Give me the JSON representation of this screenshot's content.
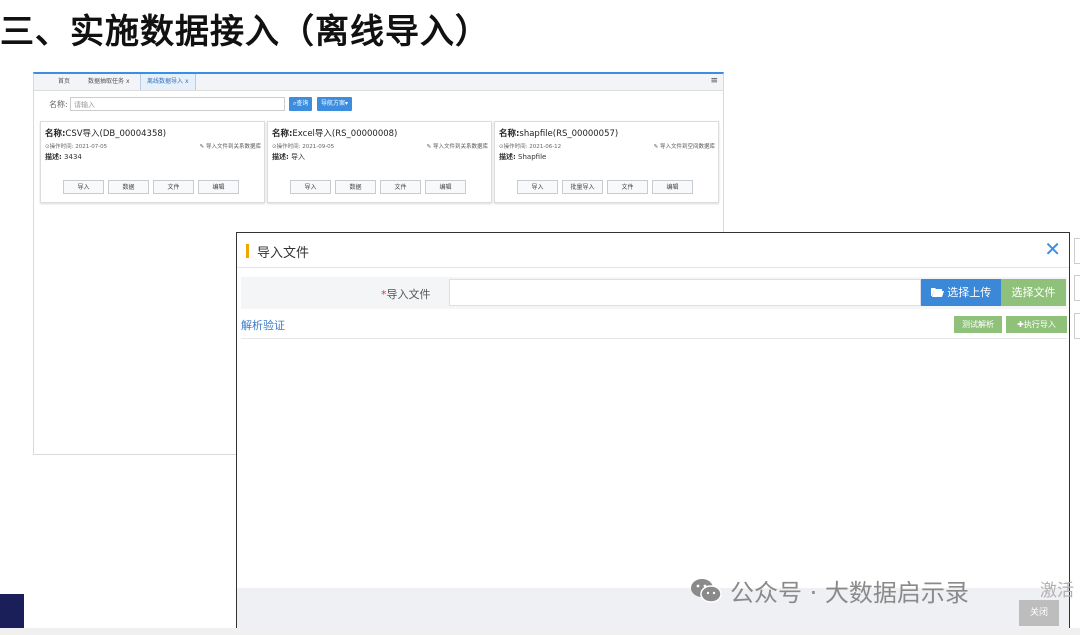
{
  "slide": {
    "title": "三、实施数据接入（离线导入）"
  },
  "app": {
    "tabs": [
      "首页",
      "数据抽取任务",
      "离线数据导入"
    ],
    "tab_close": "x",
    "search": {
      "label": "名称:",
      "placeholder": "请输入",
      "search_button": "查询",
      "plan_button": "导航方案"
    },
    "cards": [
      {
        "name_label": "名称:",
        "name": "CSV导入(DB_00004358)",
        "time_label": "⊙操作时间:",
        "time": "2021-07-05",
        "import_link": "导入文件到关系数据库",
        "desc_label": "描述:",
        "desc": "3434",
        "buttons": [
          "导入",
          "数据",
          "文件",
          "编辑"
        ]
      },
      {
        "name_label": "名称:",
        "name": "Excel导入(RS_00000008)",
        "time_label": "⊙操作时间:",
        "time": "2021-09-05",
        "import_link": "导入文件到关系数据库",
        "desc_label": "描述:",
        "desc": "导入",
        "buttons": [
          "导入",
          "数据",
          "文件",
          "编辑"
        ]
      },
      {
        "name_label": "名称:",
        "name": "shapfile(RS_00000057)",
        "time_label": "⊙操作时间:",
        "time": "2021-06-12",
        "import_link": "导入文件到空间数据库",
        "desc_label": "描述:",
        "desc": "Shapfile",
        "buttons": [
          "导入",
          "批量导入",
          "文件",
          "编辑"
        ]
      }
    ]
  },
  "modal": {
    "title": "导入文件",
    "close_icon": "close-icon",
    "form": {
      "required_mark": "*",
      "label": "导入文件",
      "value": "",
      "upload_button": "选择上传",
      "select_button": "选择文件"
    },
    "section_title": "解析验证",
    "test_parse_button": "测试解析",
    "execute_button": "执行导入",
    "footer_close_button": "关闭"
  },
  "overlay": {
    "watermark": "公众号 · 大数据启示录",
    "activate_text": "激活"
  },
  "colors": {
    "primary_blue": "#3b87d8",
    "green": "#8fc17a",
    "accent_orange": "#f0a500",
    "navy": "#1a1f5a"
  }
}
